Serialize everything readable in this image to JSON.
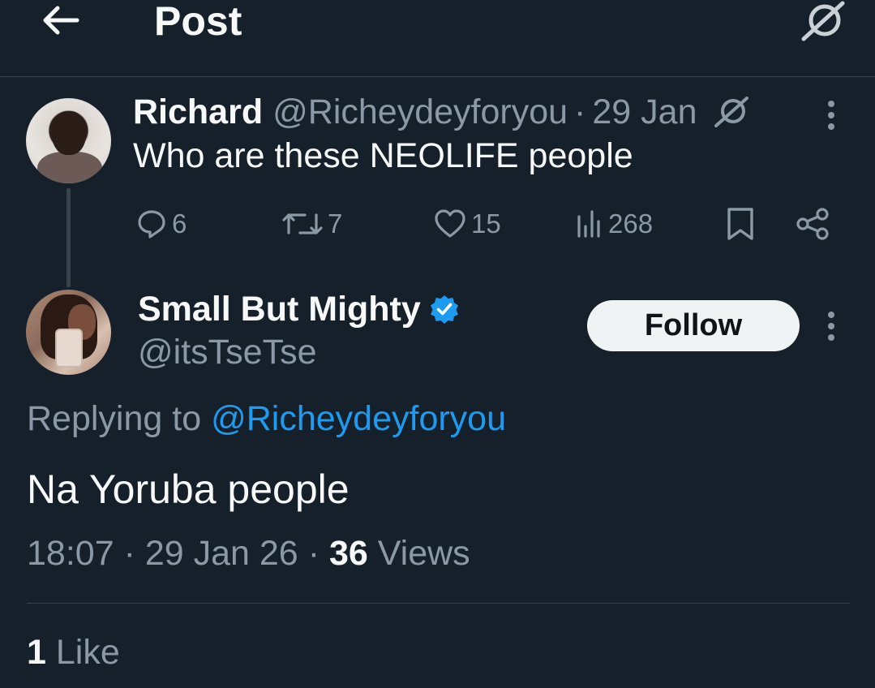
{
  "header": {
    "title": "Post",
    "back_icon": "arrow-left-icon",
    "grok_icon": "grok-icon"
  },
  "parent_post": {
    "display_name": "Richard",
    "handle": "@Richeydeyforyou",
    "separator": "·",
    "date": "29 Jan",
    "text": "Who are these NEOLIFE people",
    "actions": {
      "replies": "6",
      "reposts": "7",
      "likes": "15",
      "views": "268"
    }
  },
  "main_post": {
    "display_name": "Small But Mighty",
    "handle": "@itsTseTse",
    "verified": true,
    "follow_label": "Follow",
    "replying_prefix": "Replying to ",
    "replying_mention": "@Richeydeyforyou",
    "text": "Na Yoruba people",
    "time": "18:07",
    "separator": "·",
    "date": "29 Jan 26",
    "views_count": "36",
    "views_label": " Views",
    "likes_count": "1",
    "likes_label": " Like"
  },
  "colors": {
    "background": "#15202b",
    "text_primary": "#f7f9f9",
    "text_secondary": "#8b98a5",
    "accent": "#1d9bf0",
    "border": "#38444d"
  }
}
